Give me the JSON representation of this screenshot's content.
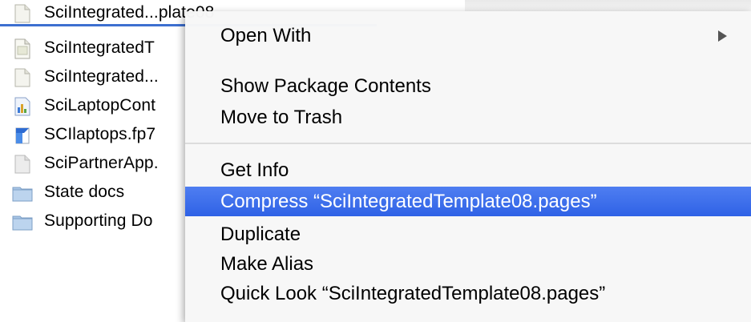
{
  "file_list": {
    "rows": [
      {
        "name": "SciIntegrated...plate08",
        "icon": "pages-document-icon",
        "selected": true
      },
      {
        "name": "SciIntegratedT",
        "icon": "pages-document-icon",
        "selected": false
      },
      {
        "name": "SciIntegrated...",
        "icon": "pages-document-icon",
        "selected": false
      },
      {
        "name": "SciLaptopCont",
        "icon": "chart-document-icon",
        "selected": false
      },
      {
        "name": "SCIlaptops.fp7",
        "icon": "filemaker-document-icon",
        "selected": false
      },
      {
        "name": "SciPartnerApp.",
        "icon": "generic-document-icon",
        "selected": false
      },
      {
        "name": "State docs",
        "icon": "folder-icon",
        "selected": false
      },
      {
        "name": "Supporting Do",
        "icon": "folder-icon",
        "selected": false
      }
    ]
  },
  "context_menu": {
    "open_with": "Open With",
    "show_package_contents": "Show Package Contents",
    "move_to_trash": "Move to Trash",
    "get_info": "Get Info",
    "compress": "Compress “SciIntegratedTemplate08.pages”",
    "duplicate": "Duplicate",
    "make_alias": "Make Alias",
    "quick_look": "Quick Look “SciIntegratedTemplate08.pages”"
  },
  "colors": {
    "selection_blue": "#3d6fd0",
    "menu_highlight": "#2f62e6"
  }
}
